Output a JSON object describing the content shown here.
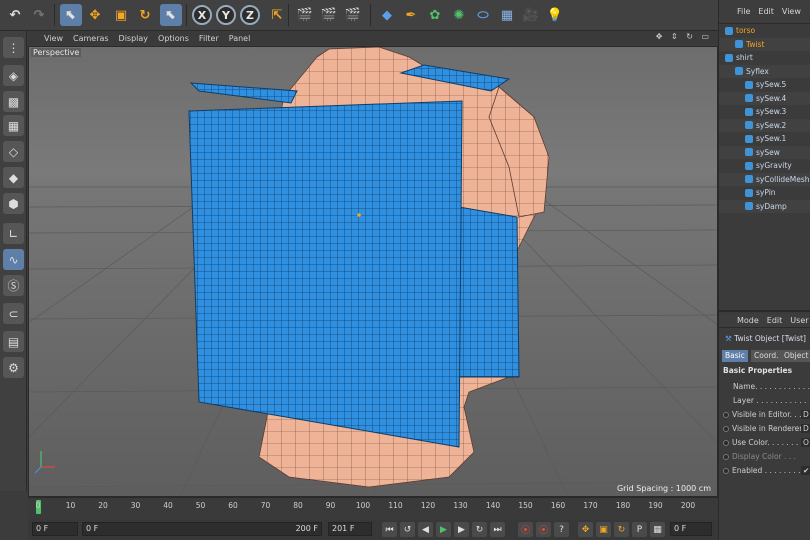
{
  "toolbar": {
    "buttons": [
      {
        "name": "undo-icon",
        "glyph": "↶"
      },
      {
        "name": "redo-icon",
        "glyph": "↷"
      },
      {
        "name": "live-selection-icon",
        "glyph": "⬉"
      },
      {
        "name": "move-icon",
        "glyph": "✥"
      },
      {
        "name": "scale-icon",
        "glyph": "▣"
      },
      {
        "name": "rotate-icon",
        "glyph": "↻"
      },
      {
        "name": "recent-tool-icon",
        "glyph": "⬉"
      },
      {
        "name": "x-axis-lock-icon",
        "glyph": "X"
      },
      {
        "name": "y-axis-lock-icon",
        "glyph": "Y"
      },
      {
        "name": "z-axis-lock-icon",
        "glyph": "Z"
      },
      {
        "name": "coordinate-system-icon",
        "glyph": "⇱"
      },
      {
        "name": "render-view-icon",
        "glyph": "🎬"
      },
      {
        "name": "render-picture-viewer-icon",
        "glyph": "🎬"
      },
      {
        "name": "render-settings-icon",
        "glyph": "🎬"
      },
      {
        "name": "cube-object-icon",
        "glyph": "◆"
      },
      {
        "name": "pen-spline-icon",
        "glyph": "✒"
      },
      {
        "name": "subdivision-icon",
        "glyph": "✿"
      },
      {
        "name": "array-icon",
        "glyph": "✺"
      },
      {
        "name": "deformer-icon",
        "glyph": "⬭"
      },
      {
        "name": "floor-icon",
        "glyph": "▦"
      },
      {
        "name": "camera-icon",
        "glyph": "🎥"
      },
      {
        "name": "light-icon",
        "glyph": "💡"
      }
    ]
  },
  "viewport": {
    "menu": [
      "View",
      "Cameras",
      "Display",
      "Options",
      "Filter",
      "Panel"
    ],
    "nav_icons": "✥ ⇕ ↻ ▭",
    "label": "Perspective",
    "grid_spacing": "Grid Spacing : 1000 cm"
  },
  "timeline": {
    "ticks": [
      "0",
      "10",
      "20",
      "30",
      "40",
      "50",
      "60",
      "70",
      "80",
      "90",
      "100",
      "110",
      "120",
      "130",
      "140",
      "150",
      "160",
      "170",
      "180",
      "190",
      "200"
    ],
    "current_frame_marker": 0
  },
  "transport": {
    "current_frame": "0 F",
    "range_start": "0 F",
    "range_end": "200 F",
    "max_frame": "201 F",
    "end_field": "0 F"
  },
  "object_manager": {
    "menu": [
      "File",
      "Edit",
      "View"
    ],
    "objects": [
      {
        "label": "torso",
        "indent": 0,
        "highlight": true
      },
      {
        "label": "Twist",
        "indent": 1,
        "highlight": true
      },
      {
        "label": "shirt",
        "indent": 0,
        "highlight": false
      },
      {
        "label": "Syflex",
        "indent": 1,
        "highlight": false
      },
      {
        "label": "sySew.5",
        "indent": 2,
        "highlight": false
      },
      {
        "label": "sySew.4",
        "indent": 2,
        "highlight": false
      },
      {
        "label": "sySew.3",
        "indent": 2,
        "highlight": false
      },
      {
        "label": "sySew.2",
        "indent": 2,
        "highlight": false
      },
      {
        "label": "sySew.1",
        "indent": 2,
        "highlight": false
      },
      {
        "label": "sySew",
        "indent": 2,
        "highlight": false
      },
      {
        "label": "syGravity",
        "indent": 2,
        "highlight": false
      },
      {
        "label": "syCollideMesh",
        "indent": 2,
        "highlight": false
      },
      {
        "label": "syPin",
        "indent": 2,
        "highlight": false
      },
      {
        "label": "syDamp",
        "indent": 2,
        "highlight": false
      }
    ]
  },
  "attribute_manager": {
    "menu": [
      "Mode",
      "Edit",
      "User D"
    ],
    "title": "Twist Object [Twist]",
    "tabs": [
      "Basic",
      "Coord.",
      "Object"
    ],
    "section": "Basic Properties",
    "props": [
      {
        "label": "Name. . . . . . . . . . . .",
        "value": "T",
        "dot": false,
        "disabled": false
      },
      {
        "label": "Layer . . . . . . . . . . .",
        "value": "",
        "dot": false,
        "disabled": false
      },
      {
        "label": "Visible in Editor. . .",
        "value": "D",
        "dot": true,
        "disabled": false
      },
      {
        "label": "Visible in Renderer",
        "value": "D",
        "dot": true,
        "disabled": false
      },
      {
        "label": "Use Color. . . . . . . .",
        "value": "O",
        "dot": true,
        "disabled": false
      },
      {
        "label": "Display Color . . .",
        "value": "",
        "dot": true,
        "disabled": true
      },
      {
        "label": "Enabled . . . . . . . . .",
        "value": "✔",
        "dot": true,
        "disabled": false
      }
    ]
  },
  "colors": {
    "cloth": "#2f8fe0",
    "skin": "#f0b59a",
    "accent": "#5d7fa8"
  }
}
